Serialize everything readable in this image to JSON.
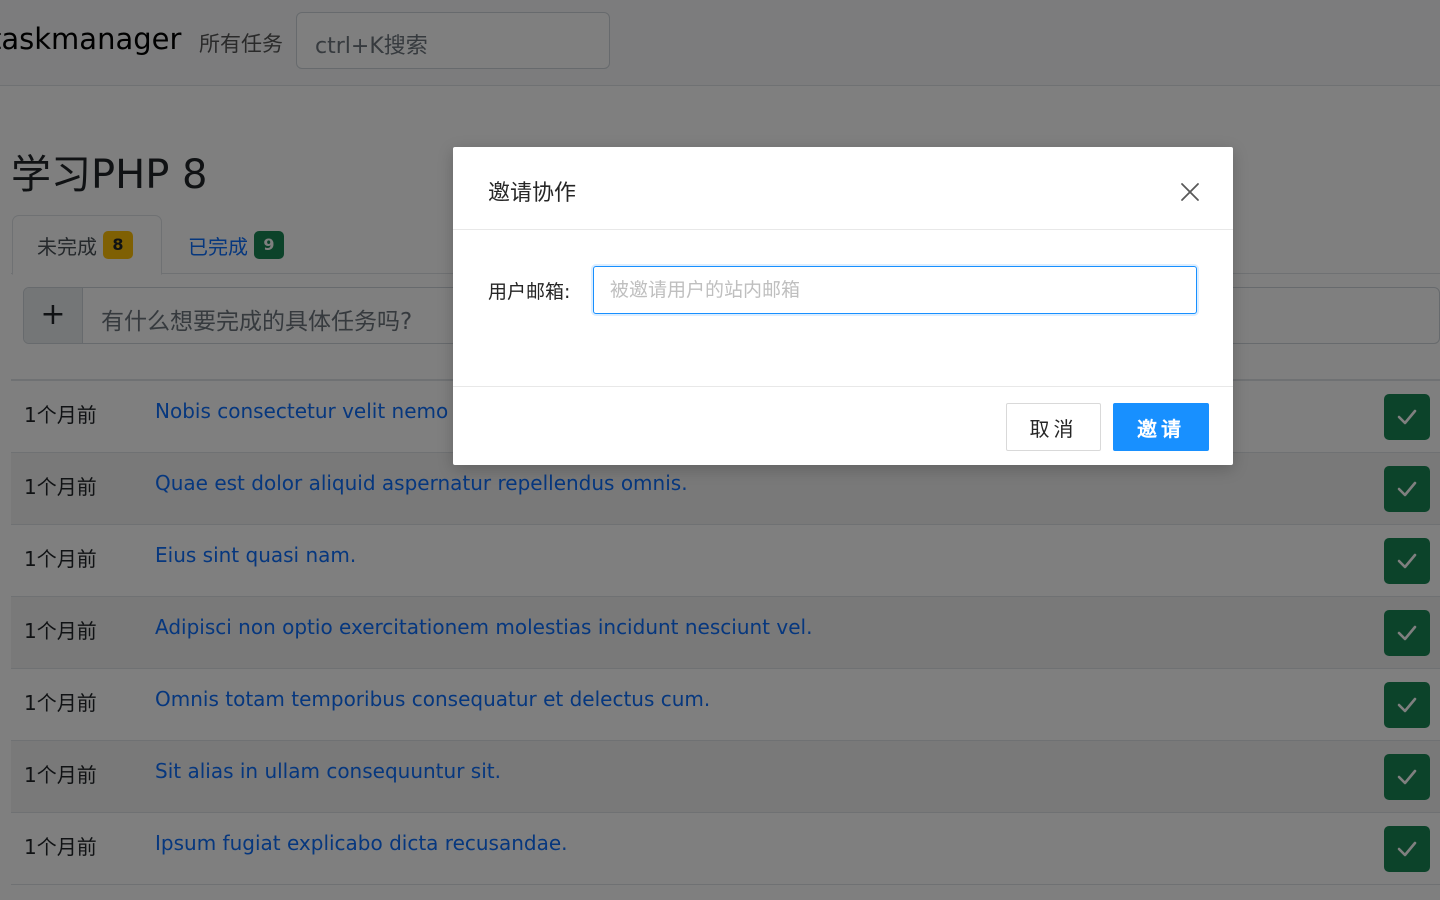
{
  "navbar": {
    "brand": "taskmanager",
    "all_tasks_link": "所有任务",
    "search_placeholder": "ctrl+K搜索"
  },
  "project": {
    "title": "学习PHP 8"
  },
  "tabs": [
    {
      "label": "未完成",
      "count": "8",
      "active": true
    },
    {
      "label": "已完成",
      "count": "9",
      "active": false
    }
  ],
  "new_task": {
    "add_symbol": "+",
    "placeholder": "有什么想要完成的具体任务吗?"
  },
  "tasks": [
    {
      "time": "1个月前",
      "title": "Nobis consectetur velit nemo do"
    },
    {
      "time": "1个月前",
      "title": "Quae est dolor aliquid aspernatur repellendus omnis."
    },
    {
      "time": "1个月前",
      "title": "Eius sint quasi nam."
    },
    {
      "time": "1个月前",
      "title": "Adipisci non optio exercitationem molestias incidunt nesciunt vel."
    },
    {
      "time": "1个月前",
      "title": "Omnis totam temporibus consequatur et delectus cum."
    },
    {
      "time": "1个月前",
      "title": "Sit alias in ullam consequuntur sit."
    },
    {
      "time": "1个月前",
      "title": "Ipsum fugiat explicabo dicta recusandae."
    }
  ],
  "modal": {
    "title": "邀请协作",
    "email_label": "用户邮箱:",
    "email_placeholder": "被邀请用户的站内邮箱",
    "email_value": "",
    "cancel_label": "取消",
    "ok_label": "邀请"
  },
  "colors": {
    "primary_link": "#0d6efd",
    "modal_primary": "#1890ff",
    "success": "#198754",
    "warning": "#ffc107"
  }
}
